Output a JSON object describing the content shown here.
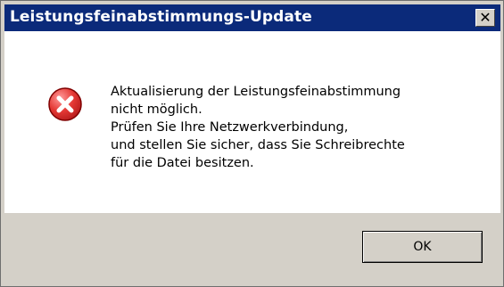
{
  "window": {
    "title": "Leistungsfeinabstimmungs-Update",
    "close_label": "✕"
  },
  "message": {
    "icon": "error-icon",
    "lines": [
      "Aktualisierung der Leistungsfeinabstimmung",
      "nicht möglich.",
      "Prüfen Sie Ihre Netzwerkverbindung,",
      "und stellen Sie sicher, dass Sie Schreibrechte",
      "für die Datei besitzen."
    ]
  },
  "buttons": {
    "ok_label": "OK"
  },
  "colors": {
    "titlebar_bg": "#0b2a7a",
    "dialog_bg": "#d4d0c8",
    "content_bg": "#ffffff",
    "error_red": "#c62828"
  }
}
